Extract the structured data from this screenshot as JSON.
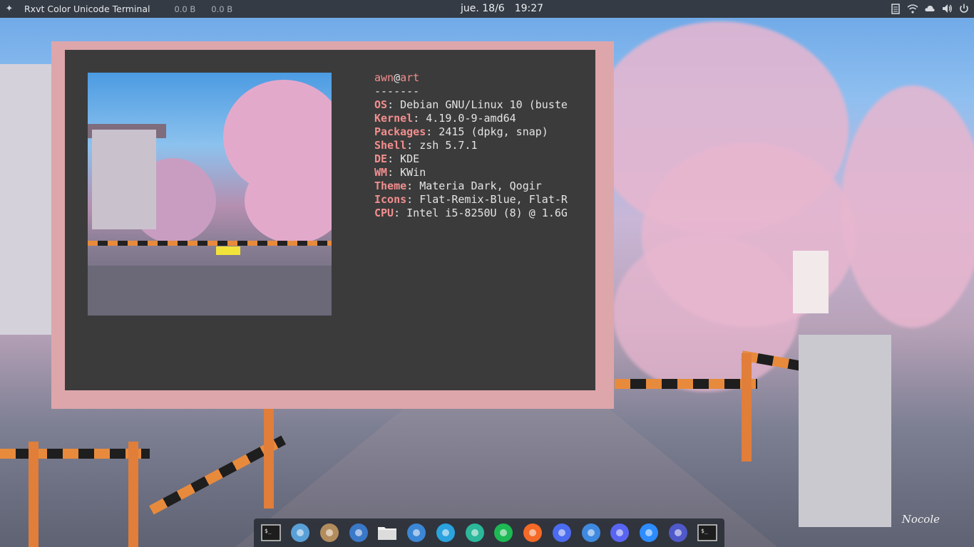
{
  "topbar": {
    "app_title": "Rxvt Color Unicode Terminal",
    "net_down": "0.0 B",
    "net_up": "0.0 B",
    "date": "jue. 18/6",
    "time": "19:27",
    "tray_icons": [
      "clipboard-icon",
      "wifi-icon",
      "cloud-icon",
      "volume-icon",
      "power-icon"
    ]
  },
  "neofetch": {
    "user": "awn",
    "at": "@",
    "host": "art",
    "separator": "-------",
    "lines": [
      {
        "key": "OS",
        "value": ": Debian GNU/Linux 10 (buste"
      },
      {
        "key": "Kernel",
        "value": ": 4.19.0-9-amd64"
      },
      {
        "key": "Packages",
        "value": ": 2415 (dpkg, snap)"
      },
      {
        "key": "Shell",
        "value": ": zsh 5.7.1"
      },
      {
        "key": "DE",
        "value": ": KDE"
      },
      {
        "key": "WM",
        "value": ": KWin"
      },
      {
        "key": "Theme",
        "value": ": Materia Dark, Qogir"
      },
      {
        "key": "Icons",
        "value": ": Flat-Remix-Blue, Flat-R"
      },
      {
        "key": "CPU",
        "value": ": Intel i5-8250U (8) @ 1.6G"
      }
    ]
  },
  "dock": {
    "apps": [
      {
        "name": "terminal-icon",
        "color": "#1d1d1d"
      },
      {
        "name": "mixer-icon",
        "color": "#5aa0d8"
      },
      {
        "name": "archive-icon",
        "color": "#b38c5e"
      },
      {
        "name": "bird-icon",
        "color": "#3a78c8"
      },
      {
        "name": "files-icon",
        "color": "#f2f2f2"
      },
      {
        "name": "mail-icon",
        "color": "#3c86d6"
      },
      {
        "name": "telegram-icon",
        "color": "#2aa3df"
      },
      {
        "name": "atom-icon",
        "color": "#2cb89a"
      },
      {
        "name": "spotify-icon",
        "color": "#1db954"
      },
      {
        "name": "firefox-icon",
        "color": "#f46a26"
      },
      {
        "name": "firefox-dev-icon",
        "color": "#4b6cf0"
      },
      {
        "name": "chromium-icon",
        "color": "#3f8ae0"
      },
      {
        "name": "discord-icon",
        "color": "#5865f2"
      },
      {
        "name": "zoom-icon",
        "color": "#2d8cff"
      },
      {
        "name": "teams-icon",
        "color": "#5059c9"
      },
      {
        "name": "terminal-icon-2",
        "color": "#1d1d1d"
      }
    ]
  },
  "wallpaper": {
    "signature": "Nocole"
  }
}
